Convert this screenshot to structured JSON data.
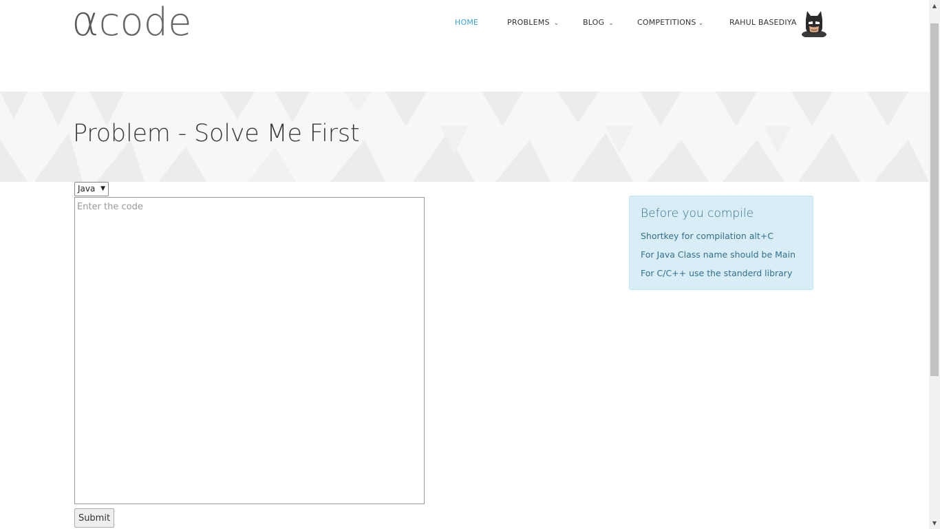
{
  "header": {
    "logo_alpha": "α",
    "logo_text": "code",
    "nav": [
      {
        "label": "HOME",
        "active": true,
        "has_dropdown": false
      },
      {
        "label": "PROBLEMS",
        "active": false,
        "has_dropdown": true
      },
      {
        "label": "BLOG",
        "active": false,
        "has_dropdown": true
      },
      {
        "label": "COMPETITIONS",
        "active": false,
        "has_dropdown": true
      },
      {
        "label": "RAHUL BASEDIYA",
        "active": false,
        "has_dropdown": false
      }
    ],
    "avatar_icon": "batman-avatar-icon",
    "accent_color": "#3ba2d4"
  },
  "banner": {
    "title": "Problem - Solve Me First"
  },
  "editor": {
    "language_selected": "Java",
    "code_placeholder": "Enter the code",
    "code_value": "",
    "submit_label": "Submit"
  },
  "info": {
    "title": "Before you compile",
    "lines": [
      "Shortkey for compilation alt+C",
      "For Java Class name should be Main",
      "For C/C++ use the standerd library"
    ],
    "background_color": "#d9edf7",
    "text_color": "#31708f"
  }
}
